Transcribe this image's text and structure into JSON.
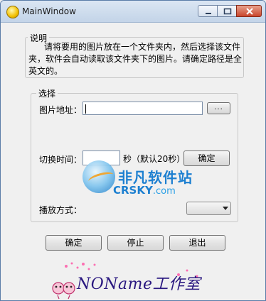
{
  "window": {
    "title": "MainWindow"
  },
  "description": {
    "legend": "说明",
    "text": "请将要用的图片放在一个文件夹内，然后选择该文件夹，软件会自动读取该文件夹下的图片。请确定路径是全英文的。"
  },
  "selection": {
    "legend": "选择",
    "image_path_label": "图片地址：",
    "image_path_value": "",
    "browse_label": "...",
    "interval_label": "切换时间：",
    "interval_value": "",
    "interval_hint": "秒（默认20秒）",
    "interval_confirm_label": "确定",
    "play_mode_label": "播放方式：",
    "play_mode_value": ""
  },
  "actions": {
    "ok_label": "确定",
    "stop_label": "停止",
    "exit_label": "退出"
  },
  "watermark": {
    "site_name": "非凡软件站",
    "site_url_main": "CRSKY",
    "site_url_tld": ".com"
  },
  "footer": {
    "brand_text": "NOName工作室"
  },
  "colors": {
    "accent_blue": "#1c7fd0",
    "close_red": "#c9462c",
    "brand_purple": "#2a1880"
  }
}
